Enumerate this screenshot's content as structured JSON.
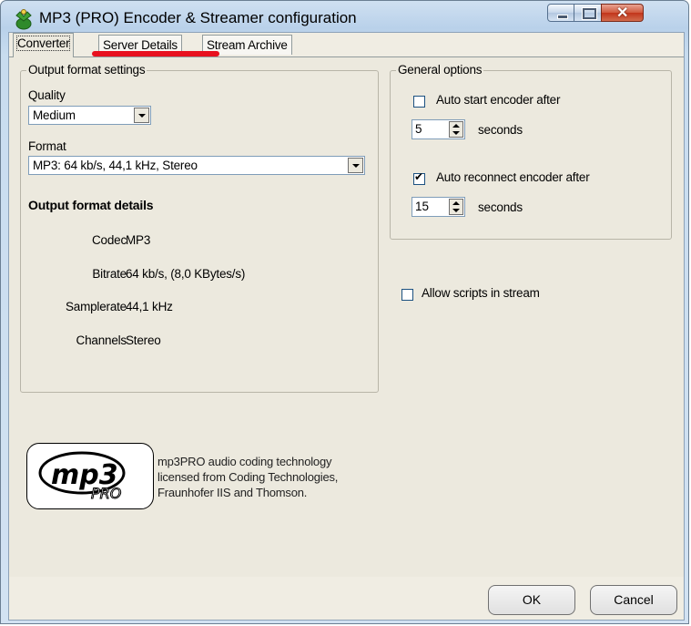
{
  "window": {
    "title": "MP3 (PRO) Encoder & Streamer configuration"
  },
  "tabs": [
    {
      "label": "Converter",
      "active": true
    },
    {
      "label": "Server Details",
      "active": false
    },
    {
      "label": "Stream Archive",
      "active": false
    }
  ],
  "output_format": {
    "group_title": "Output format settings",
    "quality_label": "Quality",
    "quality_value": "Medium",
    "format_label": "Format",
    "format_value": "MP3: 64 kb/s, 44,1 kHz, Stereo",
    "details_title": "Output format details",
    "details": [
      {
        "label": "Codec",
        "value": "MP3"
      },
      {
        "label": "Bitrate",
        "value": "64 kb/s, (8,0 KBytes/s)"
      },
      {
        "label": "Samplerate",
        "value": "44,1 kHz"
      },
      {
        "label": "Channels",
        "value": "Stereo"
      }
    ]
  },
  "general_options": {
    "group_title": "General options",
    "auto_start": {
      "label": "Auto start encoder after",
      "checked": false,
      "value": "5",
      "unit": "seconds"
    },
    "auto_reconnect": {
      "label": "Auto reconnect encoder after",
      "checked": true,
      "value": "15",
      "unit": "seconds"
    }
  },
  "allow_scripts": {
    "label": "Allow scripts in stream",
    "checked": false
  },
  "logo": {
    "line1": "mp3PRO audio coding technology",
    "line2": "licensed from Coding Technologies,",
    "line3": "Fraunhofer IIS and Thomson.",
    "mark_main": "mp3",
    "mark_sub": "PRO"
  },
  "buttons": {
    "ok": "OK",
    "cancel": "Cancel"
  },
  "colors": {
    "annotation_underline": "#e8111f",
    "close_button": "#c1351a"
  }
}
